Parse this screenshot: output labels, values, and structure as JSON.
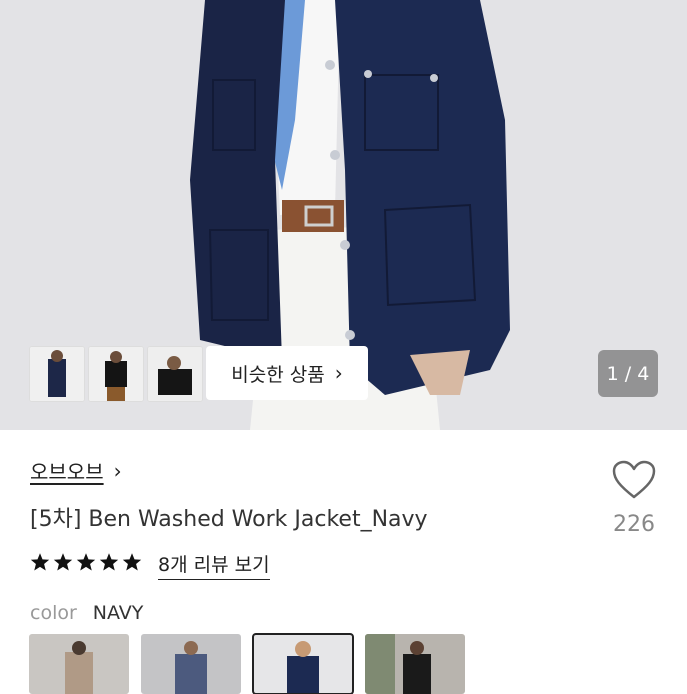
{
  "hero": {
    "image_counter": "1 / 4",
    "similar_button_label": "비슷한 상품",
    "thumbnails": [
      "thumb-1",
      "thumb-2",
      "thumb-3"
    ]
  },
  "product": {
    "brand": "오브오브",
    "title": "[5차] Ben Washed Work Jacket_Navy",
    "like_count": "226",
    "rating_stars": 5,
    "review_link": "8개 리뷰 보기",
    "color_label": "color",
    "color_value": "NAVY"
  },
  "colors": {
    "accent": "#1c2a52",
    "star": "#111111"
  },
  "icons": {
    "chevron": "chevron-right-icon",
    "heart": "heart-outline-icon",
    "star": "star-icon"
  }
}
